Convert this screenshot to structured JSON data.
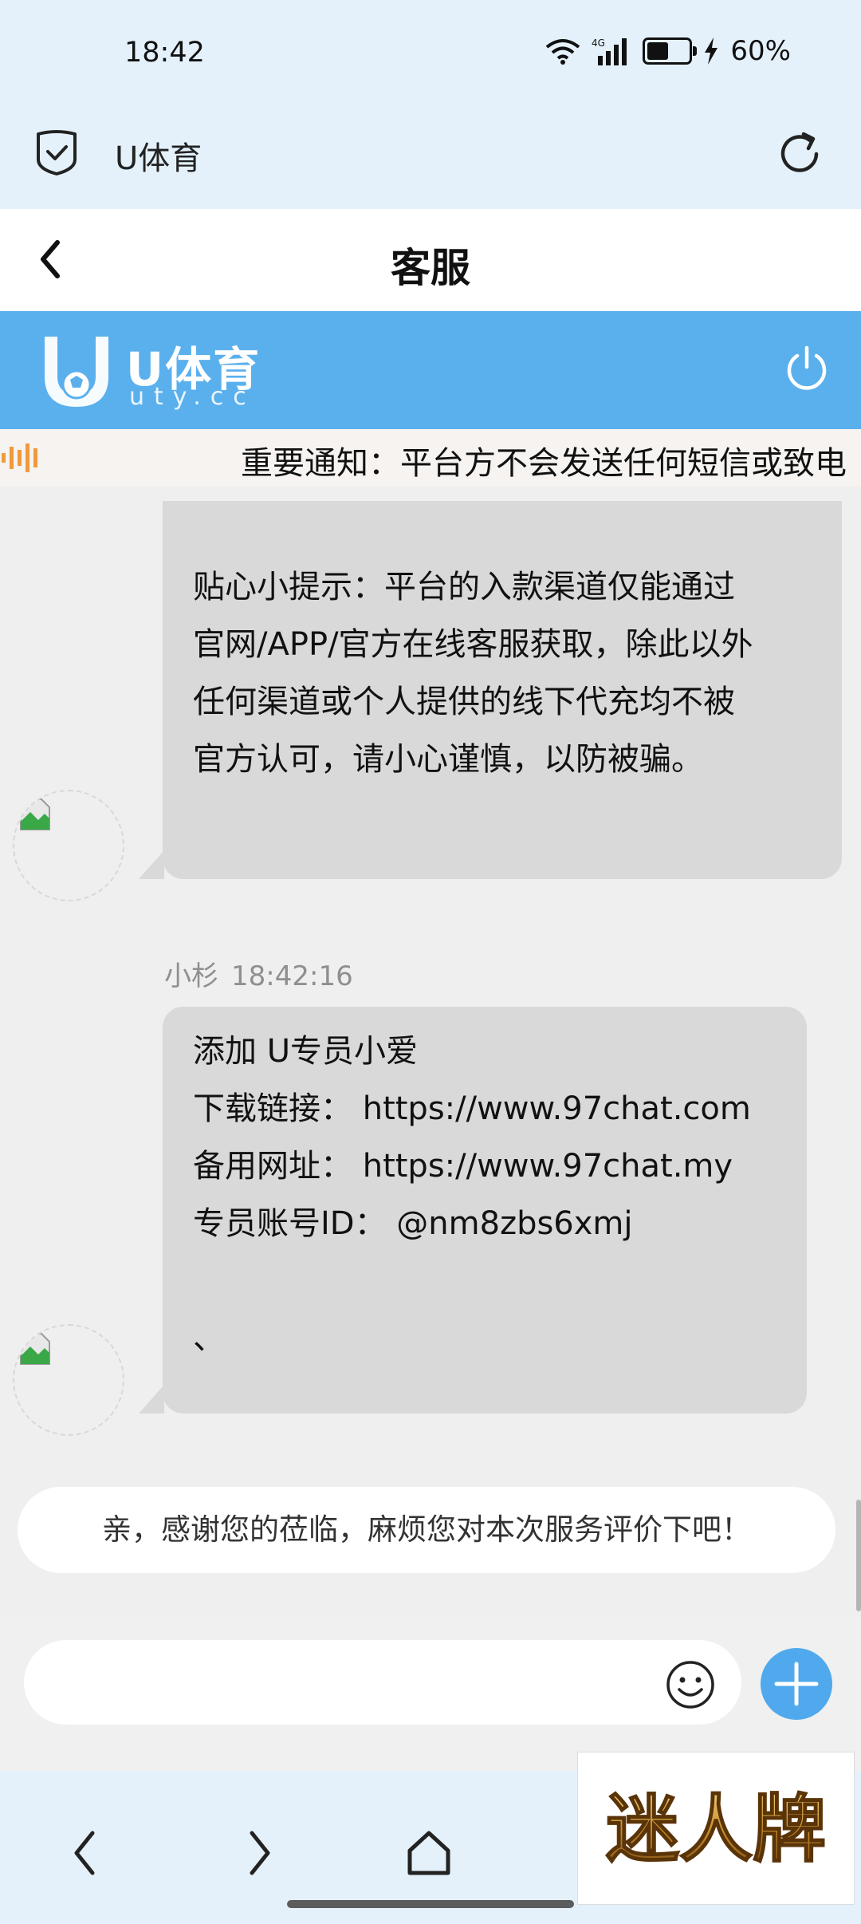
{
  "status_bar": {
    "time": "18:42",
    "network": "4G",
    "battery": "60%",
    "battery_level": 0.6
  },
  "browser": {
    "title": "U体育"
  },
  "header": {
    "title": "客服"
  },
  "brand": {
    "name": "U体育",
    "url": "uty.cc"
  },
  "notice": {
    "text": "重要通知：平台方不会发送任何短信或致电"
  },
  "messages": [
    {
      "lines": [
        "贴心小提示：平台的入款渠道仅能通过",
        "官网/APP/官方在线客服获取，除此以外",
        "任何渠道或个人提供的线下代充均不被",
        "官方认可，请小心谨慎，以防被骗。"
      ]
    },
    {
      "sender": "小杉",
      "time": "18:42:16",
      "lines": [
        "添加  U专员小爱",
        "下载链接：  https://www.97chat.com",
        "备用网址：  https://www.97chat.my",
        "专员账号ID：  @nm8zbs6xmj",
        "",
        "、"
      ]
    }
  ],
  "rating_prompt": "亲，感谢您的莅临，麻烦您对本次服务评价下吧！",
  "composer": {
    "value": "",
    "placeholder": ""
  },
  "watermark": {
    "text": "迷人牌"
  },
  "colors": {
    "brand_blue": "#5ab0ed",
    "bubble": "#d9d9d9",
    "plus_button": "#4fa9ec",
    "top_bar": "#e4f1fb"
  }
}
